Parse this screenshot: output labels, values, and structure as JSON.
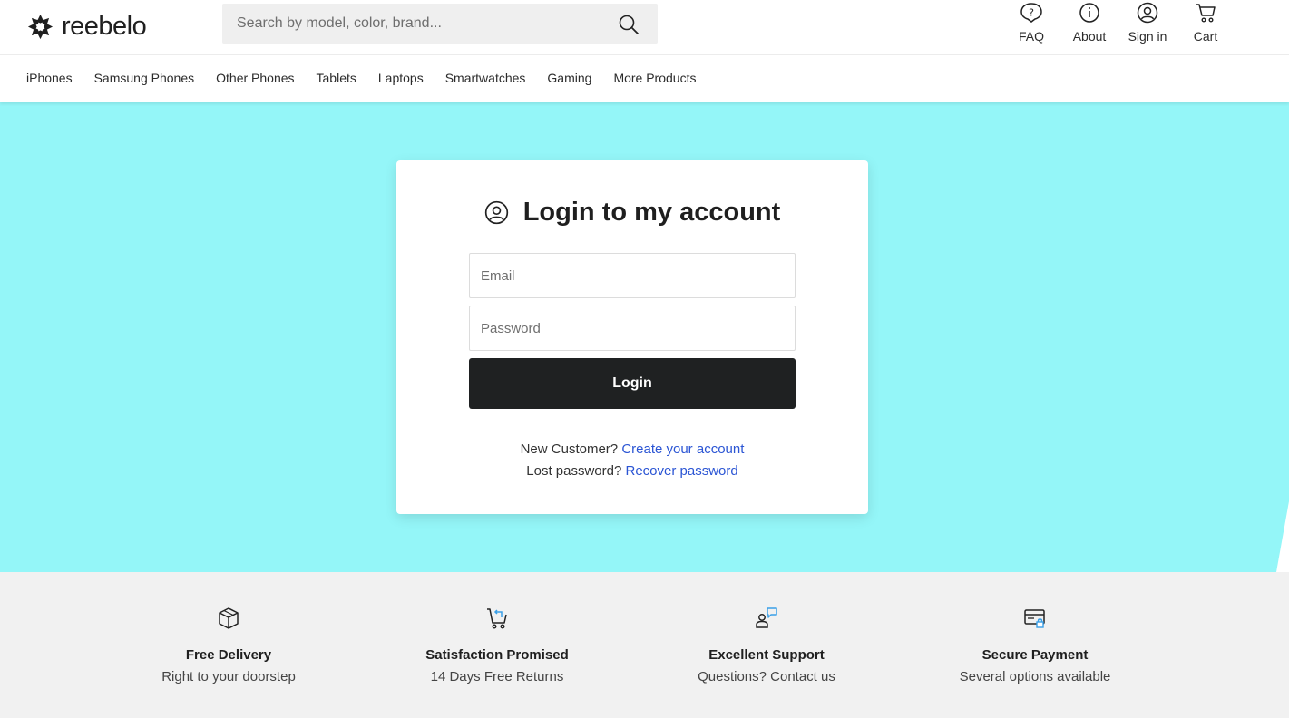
{
  "brand": {
    "name": "reebelo"
  },
  "search": {
    "placeholder": "Search by model, color, brand..."
  },
  "header_links": [
    {
      "label": "FAQ",
      "icon": "faq-icon"
    },
    {
      "label": "About",
      "icon": "info-icon"
    },
    {
      "label": "Sign in",
      "icon": "user-circle-icon"
    },
    {
      "label": "Cart",
      "icon": "cart-icon"
    }
  ],
  "categories": [
    "iPhones",
    "Samsung Phones",
    "Other Phones",
    "Tablets",
    "Laptops",
    "Smartwatches",
    "Gaming",
    "More Products"
  ],
  "login": {
    "title": "Login to my account",
    "email_placeholder": "Email",
    "password_placeholder": "Password",
    "button": "Login",
    "new_customer_text": "New Customer?",
    "create_account_link": "Create your account",
    "lost_password_text": "Lost password?",
    "recover_link": "Recover password"
  },
  "features": [
    {
      "title": "Free Delivery",
      "subtitle": "Right to your doorstep",
      "icon": "box-icon"
    },
    {
      "title": "Satisfaction Promised",
      "subtitle": "14 Days Free Returns",
      "icon": "cart-return-icon"
    },
    {
      "title": "Excellent Support",
      "subtitle": "Questions? Contact us",
      "icon": "support-icon"
    },
    {
      "title": "Secure Payment",
      "subtitle": "Several options available",
      "icon": "secure-card-icon"
    }
  ],
  "colors": {
    "hero_bg": "#94f6f8",
    "link": "#2b55d4",
    "button_bg": "#1f2122",
    "accent_icon": "#3aa0e8"
  }
}
